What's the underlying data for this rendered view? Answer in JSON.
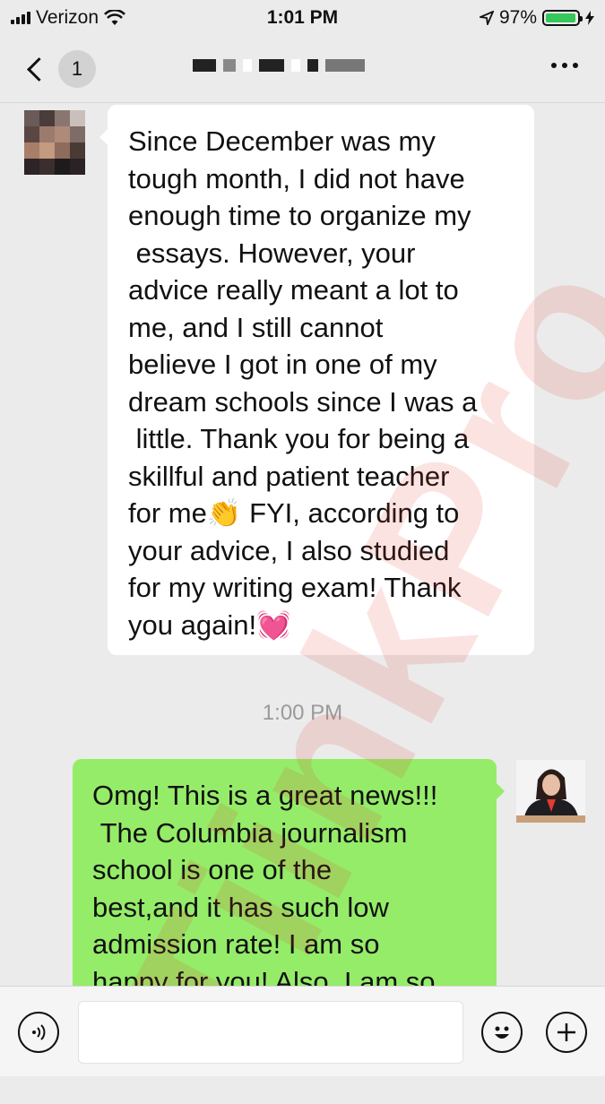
{
  "status_bar": {
    "carrier": "Verizon",
    "time": "1:01 PM",
    "battery_percent": "97%",
    "battery_level": 0.97,
    "icons": [
      "signal-icon",
      "wifi-icon",
      "location-icon",
      "battery-icon",
      "charging-icon"
    ]
  },
  "nav": {
    "unread_count": "1",
    "icons": [
      "back-chevron-icon",
      "more-icon"
    ]
  },
  "messages": [
    {
      "direction": "incoming",
      "text": "Since December was my\ntough month, I did not have\nenough time to organize my\n essays. However, your\nadvice really meant a lot to\nme, and I still cannot\nbelieve I got in one of my\ndream schools since I was a\n little. Thank you for being a\nskillful and patient teacher\nfor me👏 FYI, according to\nyour advice, I also studied\nfor my writing exam! Thank\nyou again!💓"
    },
    {
      "direction": "outgoing",
      "text": "Omg! This is a great news!!!\n The Columbia journalism\nschool is one of the\nbest,and it has such low\nadmission rate! I am so\nhappy for you! Also, I am so"
    }
  ],
  "timestamp": "1:00 PM",
  "colors": {
    "background": "#ebebeb",
    "incoming_bubble": "#ffffff",
    "outgoing_bubble": "#95ec69",
    "battery": "#35c759"
  },
  "input_bar": {
    "icons": [
      "voice-icon",
      "emoji-icon",
      "plus-icon"
    ]
  }
}
